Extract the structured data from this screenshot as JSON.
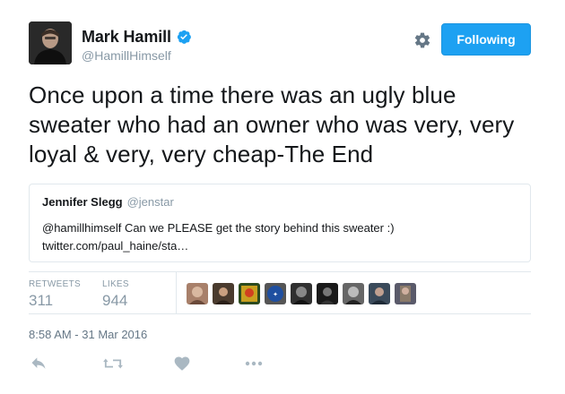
{
  "author": {
    "display_name": "Mark Hamill",
    "handle": "@HamillHimself",
    "verified": true,
    "avatar": "avatar-photo"
  },
  "header": {
    "follow_label": "Following",
    "settings_icon": "gear-icon"
  },
  "tweet": {
    "text": "Once upon a time there was an ugly blue sweater who had an owner who was very, very loyal & very, very cheap-The End"
  },
  "quote": {
    "display_name": "Jennifer Slegg",
    "handle": "@jenstar",
    "text": "@hamillhimself Can we PLEASE get the story behind this sweater :) twitter.com/paul_haine/sta…"
  },
  "stats": {
    "retweets_label": "RETWEETS",
    "retweets_count": "311",
    "likes_label": "LIKES",
    "likes_count": "944"
  },
  "timestamp": "8:58 AM - 31 Mar 2016",
  "actions": [
    "reply-icon",
    "retweet-icon",
    "like-icon",
    "more-icon"
  ],
  "colors": {
    "accent": "#1da1f2",
    "text": "#14171a",
    "muted": "#8899a6",
    "border": "#e1e8ed",
    "action_icon": "#aab8c2"
  }
}
